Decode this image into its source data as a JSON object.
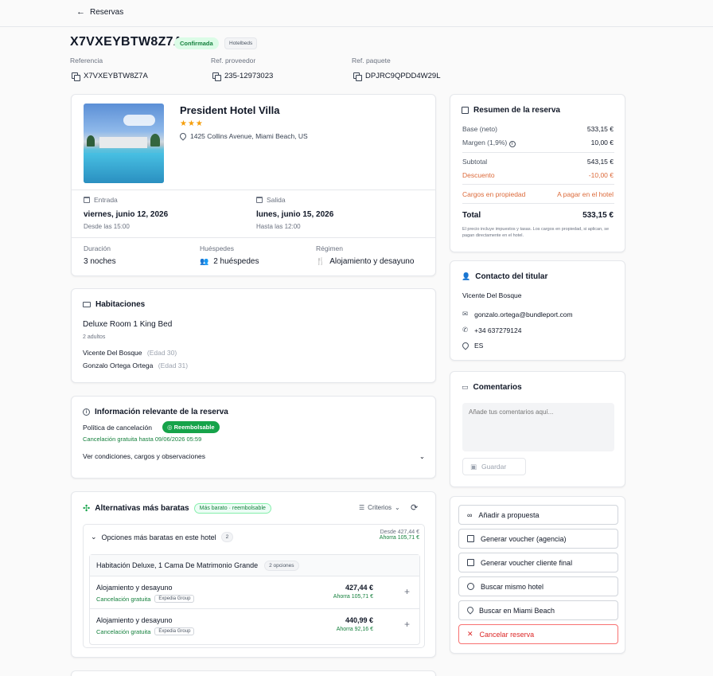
{
  "nav": {
    "back_label": "Reservas"
  },
  "header": {
    "booking_id": "X7VXEYBTW8Z7A",
    "status_badge": "Confirmada",
    "provider_badge": "Hotelbeds",
    "refs": [
      {
        "label": "Referencia",
        "value": "X7VXEYBTW8Z7A"
      },
      {
        "label": "Ref. proveedor",
        "value": "235-12973023"
      },
      {
        "label": "Ref. paquete",
        "value": "DPJRC9QPDD4W29L"
      }
    ]
  },
  "hotel": {
    "name": "President Hotel Villa",
    "stars": "★★★",
    "address": "1425 Collins Avenue, Miami Beach, US",
    "checkin_label": "Entrada",
    "checkin_date": "viernes, junio 12, 2026",
    "checkin_time": "Desde las 15:00",
    "checkout_label": "Salida",
    "checkout_date": "lunes, junio 15, 2026",
    "checkout_time": "Hasta las 12:00",
    "duration_label": "Duración",
    "duration_value": "3 noches",
    "guests_label": "Huéspedes",
    "guests_value": "2 huéspedes",
    "board_label": "Régimen",
    "board_value": "Alojamiento y desayuno"
  },
  "rooms": {
    "title": "Habitaciones",
    "room_name": "Deluxe Room 1 King Bed",
    "room_occupancy": "2 adultos",
    "guests": [
      {
        "name": "Vicente Del Bosque",
        "age": "(Edad 30)"
      },
      {
        "name": "Gonzalo Ortega Ortega",
        "age": "(Edad 31)"
      }
    ]
  },
  "info": {
    "title": "Información relevante de la reserva",
    "policy_label": "Política de cancelación",
    "policy_badge": "Reembolsable",
    "policy_note": "Cancelación gratuita hasta 09/06/2026 05:59",
    "conditions_link": "Ver condiciones, cargos y observaciones"
  },
  "alternatives": {
    "title": "Alternativas más baratas",
    "badge": "Más barato · reembolsable",
    "criteria_label": "Criterios",
    "group_title": "Opciones más baratas en este hotel",
    "group_count": "2",
    "group_from": "Desde 427,44 €",
    "group_saving": "Ahorra 105,71 €",
    "room_title": "Habitación Deluxe, 1 Cama De Matrimonio Grande",
    "room_options": "2 opciones",
    "options": [
      {
        "board": "Alojamiento y desayuno",
        "cancel": "Cancelación gratuita",
        "supplier": "Expedia Group",
        "price": "427,44 €",
        "saving": "Ahorra 105,71 €"
      },
      {
        "board": "Alojamiento y desayuno",
        "cancel": "Cancelación gratuita",
        "supplier": "Expedia Group",
        "price": "440,99 €",
        "saving": "Ahorra 92,16 €"
      }
    ]
  },
  "summary": {
    "title": "Resumen de la reserva",
    "base_label": "Base (neto)",
    "base_value": "533,15 €",
    "margin_label": "Margen (1,9%)",
    "margin_value": "10,00 €",
    "subtotal_label": "Subtotal",
    "subtotal_value": "543,15 €",
    "discount_label": "Descuento",
    "discount_value": "-10,00 €",
    "property_label": "Cargos en propiedad",
    "property_value": "A pagar en el hotel",
    "total_label": "Total",
    "total_value": "533,15 €",
    "note": "El precio incluye impuestos y tasas. Los cargos en propiedad, si aplican, se pagan directamente en el hotel."
  },
  "contact": {
    "title": "Contacto del titular",
    "name": "Vicente Del Bosque",
    "email": "gonzalo.ortega@bundleport.com",
    "phone": "+34 637279124",
    "country": "ES"
  },
  "comments": {
    "title": "Comentarios",
    "placeholder": "Añade tus comentarios aquí...",
    "save_label": "Guardar"
  },
  "actions": [
    "Añadir a propuesta",
    "Generar voucher (agencia)",
    "Generar voucher cliente final",
    "Buscar mismo hotel",
    "Buscar en Miami Beach",
    "Cancelar reserva"
  ],
  "colors": {
    "accent_green": "#16a34a",
    "danger": "#dc2626",
    "orange": "#dc6a3a"
  }
}
